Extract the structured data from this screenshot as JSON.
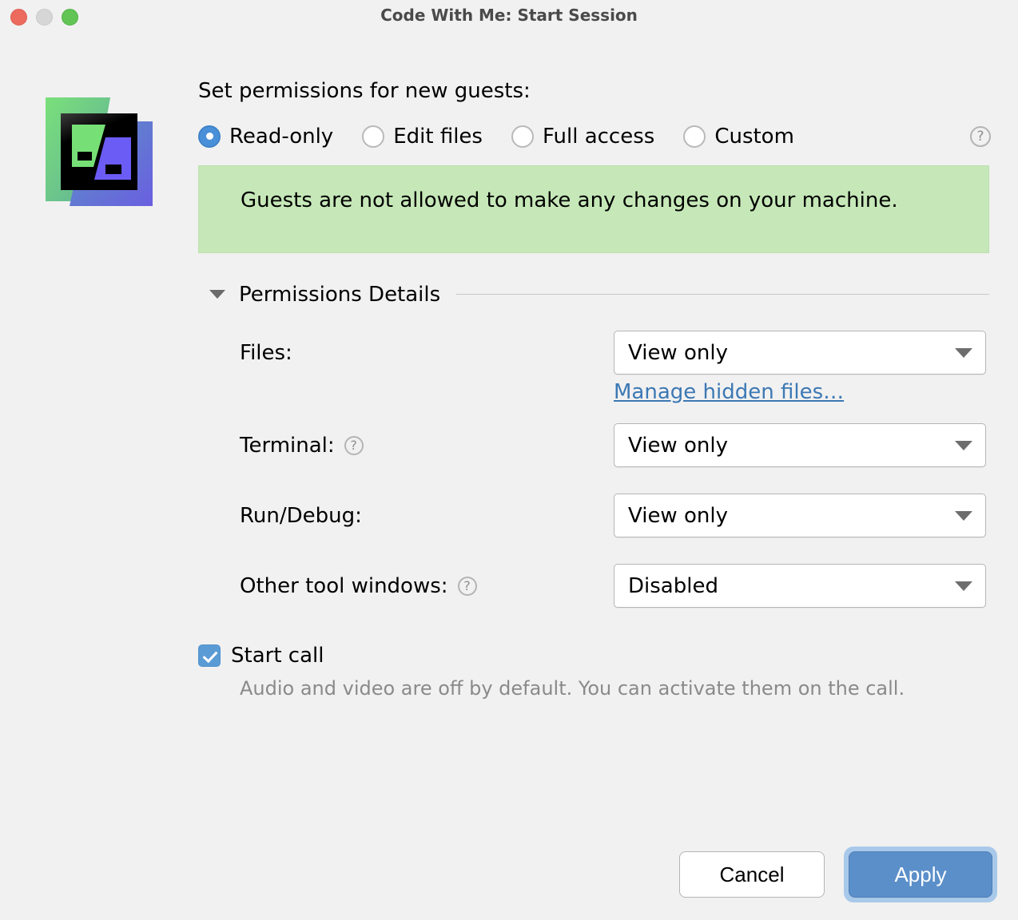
{
  "window": {
    "title": "Code With Me: Start Session",
    "traffic_lights": [
      "close",
      "minimize",
      "maximize"
    ],
    "colors": {
      "close": "#ec6a5e",
      "minimize": "#d6d6d6",
      "maximize": "#61c454",
      "accent_blue": "#4a90d9",
      "link_blue": "#3c78b4",
      "banner_green": "#c6e8b8",
      "apply_blue": "#5b8fc9",
      "background": "#f1f1f1"
    }
  },
  "logo": {
    "name": "code-with-me-logo"
  },
  "permissions": {
    "heading": "Set permissions for new guests:",
    "options": [
      {
        "label": "Read-only",
        "selected": true
      },
      {
        "label": "Edit files",
        "selected": false
      },
      {
        "label": "Full access",
        "selected": false
      },
      {
        "label": "Custom",
        "selected": false
      }
    ],
    "help_glyph": "?",
    "banner_text": "Guests are not allowed to make any changes on your machine."
  },
  "details": {
    "title": "Permissions Details",
    "expanded": true,
    "rows": [
      {
        "label": "Files:",
        "has_help": false,
        "value": "View only",
        "link": "Manage hidden files…"
      },
      {
        "label": "Terminal:",
        "has_help": true,
        "value": "View only",
        "link": null
      },
      {
        "label": "Run/Debug:",
        "has_help": false,
        "value": "View only",
        "link": null
      },
      {
        "label": "Other tool windows:",
        "has_help": true,
        "value": "Disabled",
        "link": null
      }
    ]
  },
  "start_call": {
    "label": "Start call",
    "checked": true,
    "hint": "Audio and video are off by default. You can activate them on the call."
  },
  "footer": {
    "cancel_label": "Cancel",
    "apply_label": "Apply"
  }
}
